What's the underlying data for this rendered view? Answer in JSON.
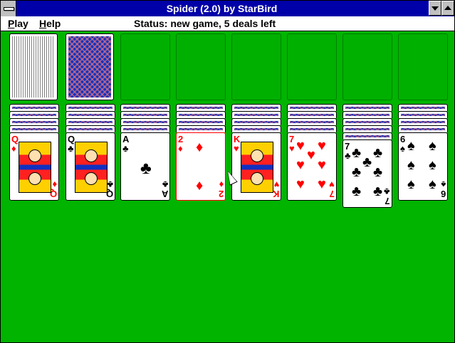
{
  "window": {
    "title": "Spider (2.0) by StarBird"
  },
  "menu": {
    "play": {
      "accel": "P",
      "rest": "lay"
    },
    "help": {
      "accel": "H",
      "rest": "elp"
    }
  },
  "status": "Status: new game, 5 deals left",
  "colors": {
    "felt": "#00b400",
    "titlebar": "#0000a8",
    "red_suit": "#ff0000"
  },
  "tableau": [
    {
      "hidden": 4,
      "top": {
        "rank": "Q",
        "suit": "♦",
        "color": "red",
        "face": true
      }
    },
    {
      "hidden": 4,
      "top": {
        "rank": "Q",
        "suit": "♣",
        "color": "black",
        "face": true
      }
    },
    {
      "hidden": 4,
      "top": {
        "rank": "A",
        "suit": "♣",
        "color": "black",
        "face": false
      }
    },
    {
      "hidden": 4,
      "top": {
        "rank": "2",
        "suit": "♦",
        "color": "red",
        "face": false
      }
    },
    {
      "hidden": 4,
      "top": {
        "rank": "K",
        "suit": "♥",
        "color": "red",
        "face": true
      }
    },
    {
      "hidden": 4,
      "top": {
        "rank": "7",
        "suit": "♥",
        "color": "red",
        "face": false
      }
    },
    {
      "hidden": 5,
      "top": {
        "rank": "7",
        "suit": "♣",
        "color": "black",
        "face": false
      }
    },
    {
      "hidden": 4,
      "top": {
        "rank": "6",
        "suit": "♠",
        "color": "black",
        "face": false
      }
    }
  ]
}
